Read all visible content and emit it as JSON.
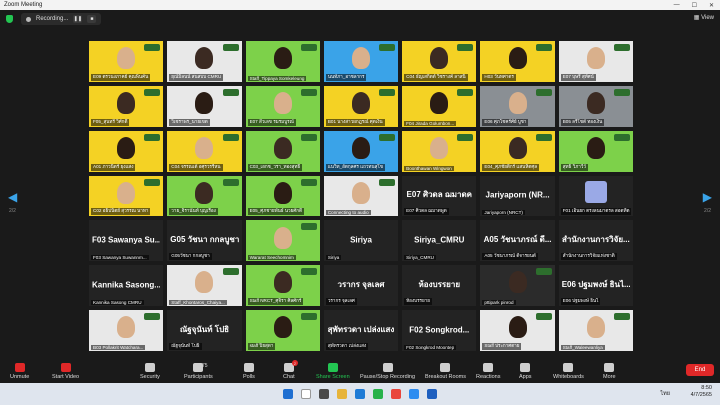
{
  "window": {
    "title": "Zoom Meeting"
  },
  "topbar": {
    "recording_label": "Recording...",
    "pause": "❚❚",
    "stop": "■",
    "view_label": "View"
  },
  "pager": {
    "left": "2/2",
    "right": "2/2"
  },
  "tiles": [
    {
      "kind": "video",
      "color": "yellow",
      "label": "E09 ตรวนงภาคย์ คุณพ็นคัน"
    },
    {
      "kind": "video",
      "color": "white",
      "label": "ยุณ์มิลนน์ สนสบบ CMRU"
    },
    {
      "kind": "video",
      "color": "green",
      "label": "Staff_Tippaya Somkeleung"
    },
    {
      "kind": "video",
      "color": "blue",
      "label": "นนท์ภา_อาชลากร"
    },
    {
      "kind": "video",
      "color": "yellow",
      "label": "C04 ธัญเสกิตต์ วิชรางค์ ลาสนิ"
    },
    {
      "kind": "video",
      "color": "yellow",
      "label": "H03 วันทศาตร"
    },
    {
      "kind": "video",
      "color": "white",
      "label": "E07 บุษรี สุทัศน์"
    },
    {
      "kind": "video",
      "color": "yellow",
      "label": "F05_สุนทรี วิศักดิ์"
    },
    {
      "kind": "video",
      "color": "white",
      "label": "วิเชราพร_นายเขต"
    },
    {
      "kind": "video",
      "color": "green",
      "label": "E07 สีวเลข รมรมบูรณ์"
    },
    {
      "kind": "video",
      "color": "yellow",
      "label": "B01 นางสาวผกฎรณ์ ศุตเงิน"
    },
    {
      "kind": "video",
      "color": "yellow",
      "label": "F04 Jirada Golumbon..."
    },
    {
      "kind": "video",
      "color": "room",
      "label": "E06 ศุภโชคร์ศัย์ บูชา"
    },
    {
      "kind": "video",
      "color": "room",
      "label": "B05 ลรีโชต์ ทองเงิน"
    },
    {
      "kind": "video",
      "color": "yellow",
      "label": "A01 ภาวนิตร์ ยุงแสง"
    },
    {
      "kind": "video",
      "color": "yellow",
      "label": "C04 จรรณเต้ อศุรวรรีหน"
    },
    {
      "kind": "video",
      "color": "green",
      "label": "C03_เอกช_วรา_ทองสุทธิ์"
    },
    {
      "kind": "video",
      "color": "blue",
      "label": "แนวิท_อัตกุลศร แถวทนสุโข"
    },
    {
      "kind": "video",
      "color": "yellow",
      "label": "Boonthawan Wingwon"
    },
    {
      "kind": "video",
      "color": "yellow",
      "label": "E04_ศุภชัยติกร์ แสนหิตศุล"
    },
    {
      "kind": "video",
      "color": "green",
      "label": "สุทธิ วิภาวีว์"
    },
    {
      "kind": "video",
      "color": "yellow",
      "label": "C02 อธิปนิตย์ สุวรรณ นาทา"
    },
    {
      "kind": "video",
      "color": "green",
      "label": "วาย_จิรานันท์ บุญเรือง"
    },
    {
      "kind": "video",
      "color": "green",
      "label": "E05_ศุภชายพันธ์ นวยศักดิ์"
    },
    {
      "kind": "video",
      "color": "white",
      "label": "Connecting to audio"
    },
    {
      "kind": "name",
      "big": "E07 ศิวดล ฌมาดค",
      "label": "E07 ศิวดล ฌมาดพูด"
    },
    {
      "kind": "name",
      "big": "Jariyaporn (NR...",
      "label": "Jariyaporn (NRCT)"
    },
    {
      "kind": "avatar",
      "label": "F01 เอ็นยก ตรงลนมาตรล สอดทีต"
    },
    {
      "kind": "name",
      "big": "F03 Sawanya Su...",
      "label": "F03 Sawanya Suwannm..."
    },
    {
      "kind": "name",
      "big": "G05 วัชนา กกลบูชา",
      "label": "G05วัชนา กกลบูชา"
    },
    {
      "kind": "video",
      "color": "green",
      "label": "Wararat Seechomnim"
    },
    {
      "kind": "name",
      "big": "Siriya",
      "label": "Siriya"
    },
    {
      "kind": "name",
      "big": "Siriya_CMRU",
      "label": "Siriya_CMRU"
    },
    {
      "kind": "name",
      "big": "A05 วัชนาภรณ์ ดี...",
      "label": "A05 วัชนาภรณ์ ดีจารยนต์"
    },
    {
      "kind": "name",
      "big": "สำนักงานการวิจัย...",
      "label": "สำนักงานการวิจัยแห่งชาติ"
    },
    {
      "kind": "name",
      "big": "Kannika Sasong...",
      "label": "Kannika Sasong CMRU"
    },
    {
      "kind": "video",
      "color": "white",
      "label": "Staff_Khontaros_Chaiya..."
    },
    {
      "kind": "video",
      "color": "green",
      "label": "Staff NRCT_ศุจิรา ศิลศักร์"
    },
    {
      "kind": "name",
      "big": "วรากร จุลเลศ",
      "label": "วรากร จุลเลศ"
    },
    {
      "kind": "name",
      "big": "ห้องบรรยาย",
      "label": "ห้องบรรยาย"
    },
    {
      "kind": "video",
      "color": "dark",
      "label": "pttipark pinrod"
    },
    {
      "kind": "name",
      "big": "E06 ปฐมพงษ์ ธินไ...",
      "label": "E06 ปฐมพงษ์ ธินไ"
    },
    {
      "kind": "video",
      "color": "white",
      "label": "B03 Pollakrit Watchara..."
    },
    {
      "kind": "name",
      "big": "ณัฐจุนันท์ โปธิ",
      "label": "ณัฐจุนันท์ โปธิ"
    },
    {
      "kind": "video",
      "color": "green",
      "label": "staff ปิยสุดา"
    },
    {
      "kind": "name",
      "big": "สุพัทรวดา เปล่งแสง",
      "label": "สุพัทรวดา เปล่งแสง"
    },
    {
      "kind": "name",
      "big": "F02 Songkrod...",
      "label": "F02 Songkrod Moontep"
    },
    {
      "kind": "video",
      "color": "white",
      "label": "Staff ประกาศตาย"
    },
    {
      "kind": "video",
      "color": "white",
      "label": "Staff_Waleewanliya"
    }
  ],
  "toolbar": {
    "unmute": "Unmute",
    "start_video": "Start Video",
    "security": "Security",
    "participants": "Participants",
    "participants_count": "75",
    "polls": "Polls",
    "chat": "Chat",
    "chat_badge": "2",
    "share": "Share Screen",
    "record": "Pause/Stop Recording",
    "breakout": "Breakout Rooms",
    "reactions": "Reactions",
    "apps": "Apps",
    "whiteboards": "Whiteboards",
    "more": "More",
    "end": "End"
  },
  "taskbar": {
    "lang": "ไทย",
    "time": "8:50",
    "date": "4/7/2565"
  },
  "colors": {
    "accent_green": "#23c552",
    "end_red": "#e02828",
    "zoom_blue": "#3aa3e8"
  }
}
